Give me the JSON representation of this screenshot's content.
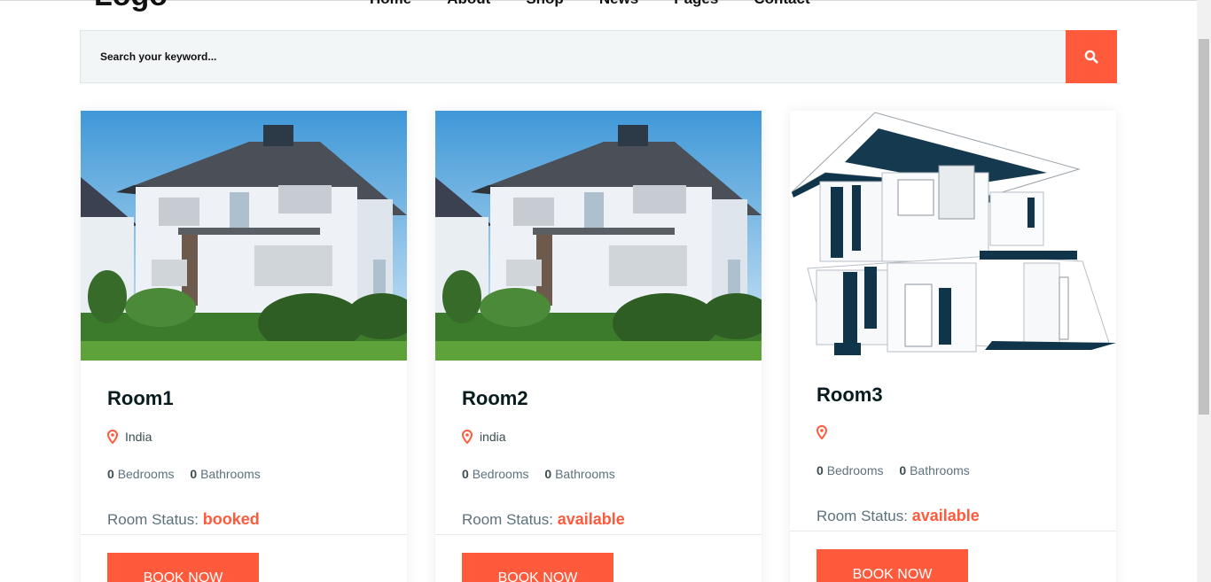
{
  "header": {
    "logo": "Logo",
    "nav": [
      "Home",
      "About",
      "Shop",
      "News",
      "Pages",
      "Contact"
    ]
  },
  "search": {
    "placeholder": "Search your keyword...",
    "button_icon": "search-icon"
  },
  "rooms": [
    {
      "title": "Room1",
      "location": "India",
      "bedrooms": "0",
      "bedrooms_label": "Bedrooms",
      "bathrooms": "0",
      "bathrooms_label": "Bathrooms",
      "status_label": "Room Status:",
      "status": "booked",
      "button": "BOOK NOW",
      "image": "photo of white two-story house with garden"
    },
    {
      "title": "Room2",
      "location": "india",
      "bedrooms": "0",
      "bedrooms_label": "Bedrooms",
      "bathrooms": "0",
      "bathrooms_label": "Bathrooms",
      "status_label": "Room Status:",
      "status": "available",
      "button": "BOOK NOW",
      "image": "photo of white two-story house with garden"
    },
    {
      "title": "Room3",
      "location": "",
      "bedrooms": "0",
      "bedrooms_label": "Bedrooms",
      "bathrooms": "0",
      "bathrooms_label": "Bathrooms",
      "status_label": "Room Status:",
      "status": "available",
      "button": "BOOK NOW",
      "image": "3D model render of modern house"
    }
  ],
  "colors": {
    "accent": "#ff5a3c",
    "title": "#071c1f",
    "text": "#5c727d",
    "search_bg": "#f3f6f6"
  }
}
